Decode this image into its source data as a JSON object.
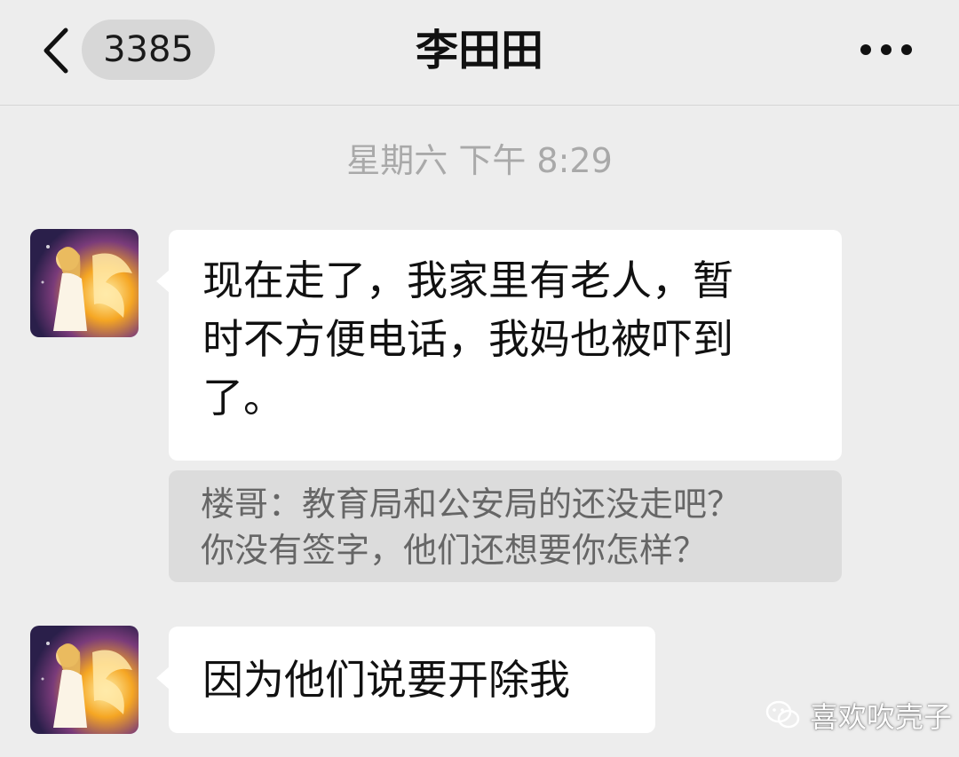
{
  "header": {
    "back_icon": "chevron-left-icon",
    "unread_count": "3385",
    "title": "李田田",
    "more_icon": "ellipsis-icon"
  },
  "timestamp": "星期六 下午 8:29",
  "messages": [
    {
      "text_lines": [
        "现在走了，我家里有老人，暂",
        "时不方便电话，我妈也被吓到",
        "了。"
      ],
      "quote": {
        "lines": [
          "楼哥：教育局和公安局的还没走吧？",
          "你没有签字，他们还想要你怎样？"
        ]
      }
    },
    {
      "text_lines": [
        "因为他们说要开除我"
      ]
    }
  ],
  "watermark": {
    "icon": "wechat-icon",
    "text": "喜欢吹壳子"
  },
  "colors": {
    "background": "#ededed",
    "bubble": "#ffffff",
    "quote_bg": "#dcdcdc",
    "pill_bg": "#d7d7d7"
  }
}
